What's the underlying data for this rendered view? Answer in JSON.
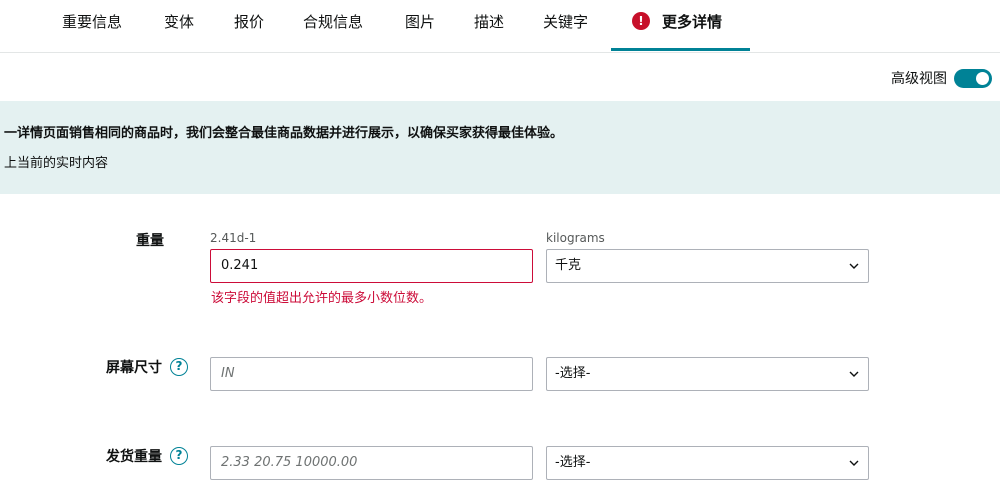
{
  "tabs": [
    {
      "label": "重要信息"
    },
    {
      "label": "变体"
    },
    {
      "label": "报价"
    },
    {
      "label": "合规信息"
    },
    {
      "label": "图片"
    },
    {
      "label": "描述"
    },
    {
      "label": "关键字"
    },
    {
      "label": "更多详情",
      "active": true,
      "icon": "alert-icon",
      "icon_glyph": "!"
    }
  ],
  "advanced_view": {
    "label": "高级视图",
    "enabled": true
  },
  "banner": {
    "line1": "一详情页面销售相同的商品时，我们会整合最佳商品数据并进行展示，以确保买家获得最佳体验。",
    "line2": "上当前的实时内容"
  },
  "fields": {
    "weight": {
      "label": "重量",
      "value_hint": "2.41d-1",
      "value": "0.241",
      "unit_hint": "kilograms",
      "unit": "千克",
      "error": "该字段的值超出允许的最多小数位数。"
    },
    "screen_size": {
      "label": "屏幕尺寸",
      "help_glyph": "?",
      "placeholder": "IN",
      "unit": "-选择-"
    },
    "shipping_weight": {
      "label": "发货重量",
      "help_glyph": "?",
      "placeholder": "2.33 20.75 10000.00",
      "unit": "-选择-"
    }
  },
  "colors": {
    "accent": "#008296",
    "error": "#cc0c39",
    "banner_bg": "#e4f1f1",
    "alert": "#c7102a"
  }
}
